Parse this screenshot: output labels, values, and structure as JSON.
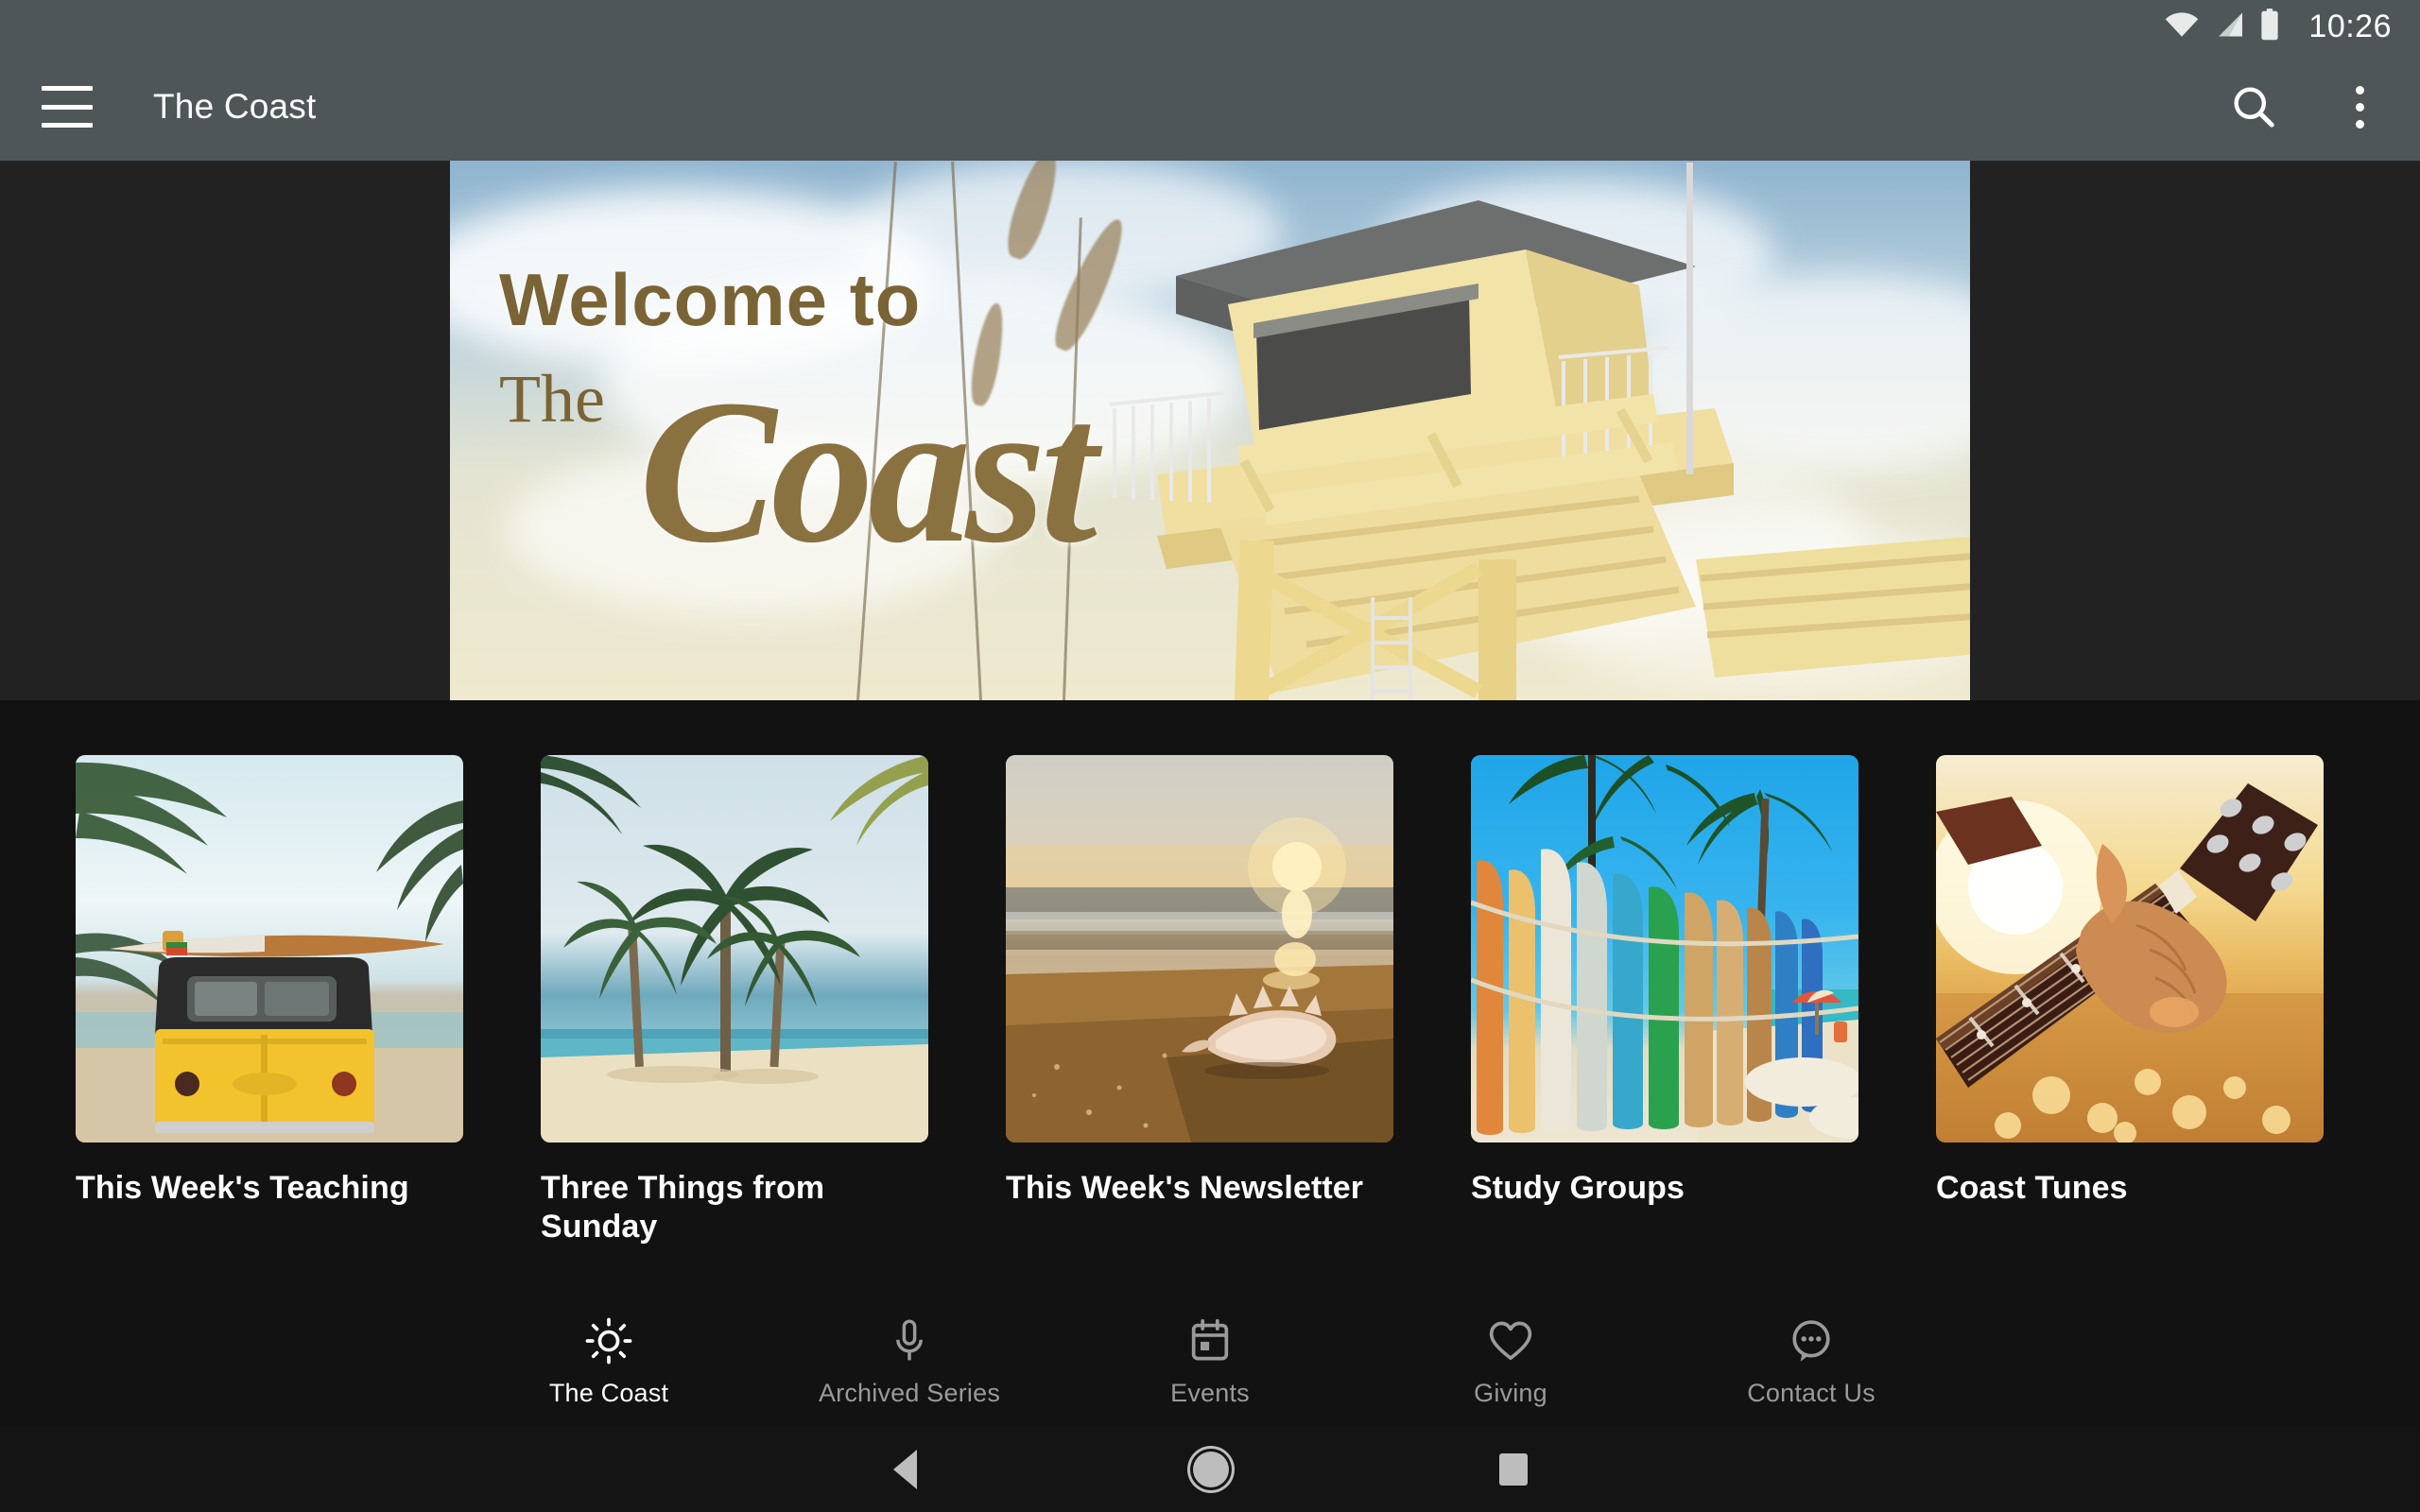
{
  "status_bar": {
    "time": "10:26",
    "icons": [
      "wifi-icon",
      "cellular-signal-icon",
      "battery-icon"
    ]
  },
  "app_bar": {
    "menu_icon": "hamburger-menu-icon",
    "title": "The Coast",
    "search_icon": "search-icon",
    "overflow_icon": "more-vertical-icon"
  },
  "hero": {
    "line1": "Welcome to",
    "line2": "The",
    "line3": "Coast",
    "alt": "lifeguard-tower-beach-banner",
    "text_color": "#7a6436"
  },
  "cards": [
    {
      "title": "This Week's Teaching",
      "image": "yellow-vw-bus-with-surfboard-on-beach"
    },
    {
      "title": "Three Things from Sunday",
      "image": "palm-trees-on-white-sand-beach"
    },
    {
      "title": "This Week's Newsletter",
      "image": "seashell-on-sand-at-sunset"
    },
    {
      "title": "Study Groups",
      "image": "surfboards-lined-up-by-palm-trees"
    },
    {
      "title": "Coast Tunes",
      "image": "hand-on-guitar-neck-at-sunset"
    }
  ],
  "bottom_nav": {
    "items": [
      {
        "label": "The Coast",
        "icon": "sun-icon",
        "active": true
      },
      {
        "label": "Archived Series",
        "icon": "microphone-icon",
        "active": false
      },
      {
        "label": "Events",
        "icon": "calendar-icon",
        "active": false
      },
      {
        "label": "Giving",
        "icon": "heart-icon",
        "active": false
      },
      {
        "label": "Contact Us",
        "icon": "chat-bubble-icon",
        "active": false
      }
    ],
    "active_color": "#ffffff",
    "inactive_color": "#9a9a9a"
  },
  "android_nav": {
    "back": "back-triangle-icon",
    "home": "home-circle-icon",
    "recents": "recents-square-icon"
  },
  "theme": {
    "appbar_bg": "#4f5658",
    "page_bg": "#121212",
    "hero_band_bg": "#222222"
  }
}
